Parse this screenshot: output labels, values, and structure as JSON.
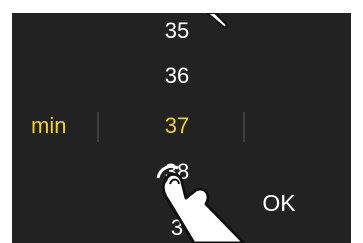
{
  "picker": {
    "unit_label": "min",
    "values": [
      "35",
      "36",
      "37",
      "38",
      "3"
    ],
    "selected_value": "37",
    "ok_label": "OK"
  },
  "colors": {
    "background": "#222222",
    "accent": "#f2d21b",
    "text": "#ffffff"
  },
  "icons": {
    "pointer": "finger-tap-icon"
  }
}
